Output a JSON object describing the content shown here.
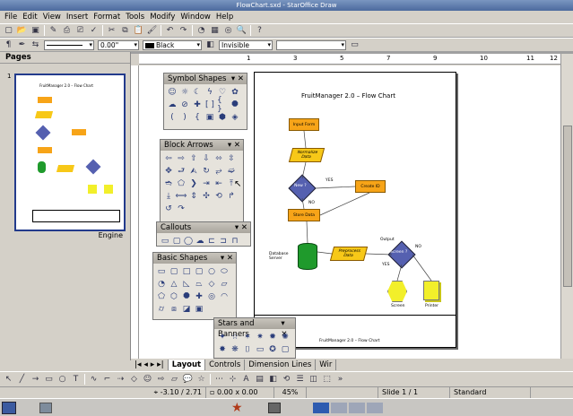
{
  "window": {
    "title": "FlowChart.sxd - StarOffice Draw"
  },
  "menu": [
    "File",
    "Edit",
    "View",
    "Insert",
    "Format",
    "Tools",
    "Modify",
    "Window",
    "Help"
  ],
  "toolbar2": {
    "line_width": "0.00\"",
    "line_color": "Black",
    "area_style": "Invisible"
  },
  "pages_panel": {
    "title": "Pages",
    "page_number": "1",
    "caption": "Engine"
  },
  "flowchart": {
    "title": "FruitManager 2.0 – Flow Chart",
    "input_form": "Input Form",
    "normalize": "Normalize Data",
    "new": "New ?",
    "yes1": "YES",
    "no1": "NO",
    "create_id": "Create ID",
    "store_data": "Store Data",
    "db_server": "Database Server",
    "preprocess": "Preprocess Data",
    "output": "Output",
    "screen_q": "Screen ?",
    "no2": "NO",
    "yes2": "YES",
    "screen": "Screen",
    "printer": "Printer",
    "tb_drawing_title": "FruitManager 2.0 – Flow Chart"
  },
  "palettes": {
    "symbol": "Symbol Shapes",
    "block": "Block Arrows",
    "callouts": "Callouts",
    "basic": "Basic Shapes",
    "stars": "Stars and Banners"
  },
  "tabs": [
    "Layout",
    "Controls",
    "Dimension Lines",
    "Wir"
  ],
  "status": {
    "position": "-3.10 / 2.71",
    "size": "0.00 x 0.00",
    "zoom": "45%",
    "slide": "Slide 1 / 1",
    "layout": "Standard"
  }
}
